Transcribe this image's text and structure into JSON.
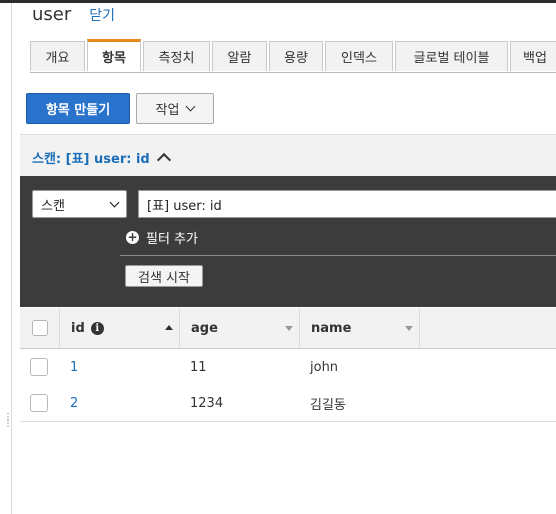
{
  "header": {
    "title": "user",
    "close_label": "닫기"
  },
  "tabs": [
    {
      "label": "개요",
      "active": false
    },
    {
      "label": "항목",
      "active": true
    },
    {
      "label": "측정치",
      "active": false
    },
    {
      "label": "알람",
      "active": false
    },
    {
      "label": "용량",
      "active": false
    },
    {
      "label": "인덱스",
      "active": false
    },
    {
      "label": "글로벌 테이블",
      "active": false
    },
    {
      "label": "백업",
      "active": false
    }
  ],
  "toolbar": {
    "create_item_label": "항목 만들기",
    "actions_label": "작업"
  },
  "scan": {
    "title": "스캔: [표] user: id",
    "mode": "스캔",
    "target": "[표] user: id",
    "add_filter_label": "필터 추가",
    "start_search_label": "검색 시작"
  },
  "table": {
    "columns": [
      "id",
      "age",
      "name"
    ],
    "rows": [
      {
        "id": "1",
        "age": "11",
        "name": "john"
      },
      {
        "id": "2",
        "age": "1234",
        "name": "김길동"
      }
    ]
  },
  "colors": {
    "primary": "#2a73cc",
    "link": "#1c6fb8",
    "active_tab_accent": "#e8891d",
    "panel": "#3c3c3c"
  }
}
